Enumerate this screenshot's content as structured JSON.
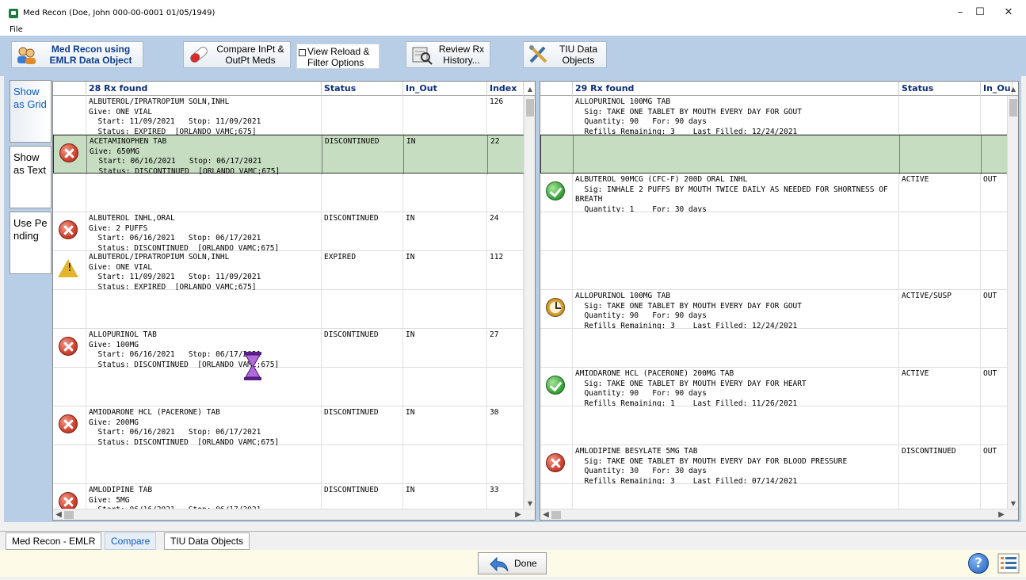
{
  "window": {
    "title": "Med Recon (Doe, John  000-00-0001  01/05/1949)",
    "minimize": "–",
    "maximize": "☐",
    "close": "✕"
  },
  "menu": {
    "file": "File"
  },
  "toolbar": {
    "med_recon": "Med Recon using EMLR Data Object",
    "compare": "Compare InPt & OutPt Meds",
    "view_reload": "View Reload & Filter Options",
    "review_rx": "Review Rx History...",
    "tiu": "TIU Data Objects"
  },
  "side_tabs": [
    "Show as Grid",
    "Show as Text",
    "Use Pending"
  ],
  "left": {
    "headers": {
      "name": "28 Rx found",
      "status": "Status",
      "in_out": "In_Out",
      "index": "Index"
    },
    "rows": [
      {
        "icon": "none",
        "text": "ALBUTEROL/IPRATROPIUM SOLN,INHL\nGive: ONE VIAL\n  Start: 11/09/2021   Stop: 11/09/2021\n  Status: EXPIRED  [ORLANDO VAMC;675]",
        "status": "",
        "in_out": "",
        "index": "126"
      },
      {
        "icon": "x",
        "text": "ACETAMINOPHEN TAB\nGive: 650MG\n  Start: 06/16/2021   Stop: 06/17/2021\n  Status: DISCONTINUED  [ORLANDO VAMC;675]",
        "status": "DISCONTINUED",
        "in_out": "IN",
        "index": "22",
        "selected": true
      },
      {
        "icon": "none",
        "text": "",
        "status": "",
        "in_out": "",
        "index": ""
      },
      {
        "icon": "x",
        "text": "ALBUTEROL INHL,ORAL\nGive: 2 PUFFS\n  Start: 06/16/2021   Stop: 06/17/2021\n  Status: DISCONTINUED  [ORLANDO VAMC;675]",
        "status": "DISCONTINUED",
        "in_out": "IN",
        "index": "24"
      },
      {
        "icon": "warn",
        "text": "ALBUTEROL/IPRATROPIUM SOLN,INHL\nGive: ONE VIAL\n  Start: 11/09/2021   Stop: 11/09/2021\n  Status: EXPIRED  [ORLANDO VAMC;675]",
        "status": "EXPIRED",
        "in_out": "IN",
        "index": "112"
      },
      {
        "icon": "none",
        "text": "",
        "status": "",
        "in_out": "",
        "index": ""
      },
      {
        "icon": "x",
        "text": "ALLOPURINOL TAB\nGive: 100MG\n  Start: 06/16/2021   Stop: 06/17/2021\n  Status: DISCONTINUED  [ORLANDO VAMC;675]",
        "status": "DISCONTINUED",
        "in_out": "IN",
        "index": "27"
      },
      {
        "icon": "none",
        "text": "",
        "status": "",
        "in_out": "",
        "index": ""
      },
      {
        "icon": "x",
        "text": "AMIODARONE HCL (PACERONE) TAB\nGive: 200MG\n  Start: 06/16/2021   Stop: 06/17/2021\n  Status: DISCONTINUED  [ORLANDO VAMC;675]",
        "status": "DISCONTINUED",
        "in_out": "IN",
        "index": "30"
      },
      {
        "icon": "none",
        "text": "",
        "status": "",
        "in_out": "",
        "index": ""
      },
      {
        "icon": "x",
        "text": "AMLODIPINE TAB\nGive: 5MG\n  Start: 06/16/2021   Stop: 06/17/2021",
        "status": "DISCONTINUED",
        "in_out": "IN",
        "index": "33"
      }
    ]
  },
  "right": {
    "headers": {
      "name": "29 Rx found",
      "status": "Status",
      "in_out": "In_Ou"
    },
    "rows": [
      {
        "icon": "none",
        "text": "ALLOPURINOL 100MG TAB\n  Sig: TAKE ONE TABLET BY MOUTH EVERY DAY FOR GOUT\n  Quantity: 90   For: 90 days\n  Refills Remaining: 3    Last Filled: 12/24/2021",
        "status": "",
        "in_out": ""
      },
      {
        "icon": "none",
        "text": "",
        "status": "",
        "in_out": "",
        "selected": true
      },
      {
        "icon": "ok",
        "text": "ALBUTEROL 90MCG (CFC-F) 200D ORAL INHL\n  Sig: INHALE 2 PUFFS BY MOUTH TWICE DAILY AS NEEDED FOR SHORTNESS OF\nBREATH\n  Quantity: 1    For: 30 days",
        "status": "ACTIVE",
        "in_out": "OUT"
      },
      {
        "icon": "none",
        "text": "",
        "status": "",
        "in_out": ""
      },
      {
        "icon": "none",
        "text": "",
        "status": "",
        "in_out": ""
      },
      {
        "icon": "clock",
        "text": "ALLOPURINOL 100MG TAB\n  Sig: TAKE ONE TABLET BY MOUTH EVERY DAY FOR GOUT\n  Quantity: 90   For: 90 days\n  Refills Remaining: 3    Last Filled: 12/24/2021",
        "status": "ACTIVE/SUSP",
        "in_out": "OUT"
      },
      {
        "icon": "none",
        "text": "",
        "status": "",
        "in_out": ""
      },
      {
        "icon": "ok",
        "text": "AMIODARONE HCL (PACERONE) 200MG TAB\n  Sig: TAKE ONE TABLET BY MOUTH EVERY DAY FOR HEART\n  Quantity: 90   For: 90 days\n  Refills Remaining: 1    Last Filled: 11/26/2021",
        "status": "ACTIVE",
        "in_out": "OUT"
      },
      {
        "icon": "none",
        "text": "",
        "status": "",
        "in_out": ""
      },
      {
        "icon": "x",
        "text": "AMLODIPINE BESYLATE 5MG TAB\n  Sig: TAKE ONE TABLET BY MOUTH EVERY DAY FOR BLOOD PRESSURE\n  Quantity: 30   For: 30 days\n  Refills Remaining: 3    Last Filled: 07/14/2021",
        "status": "DISCONTINUED",
        "in_out": "OUT"
      },
      {
        "icon": "none",
        "text": "",
        "status": "",
        "in_out": ""
      }
    ]
  },
  "bottom_tabs": [
    "Med Recon - EMLR",
    "Compare",
    "TIU Data Objects"
  ],
  "footer": {
    "done": "Done",
    "help": "?"
  }
}
